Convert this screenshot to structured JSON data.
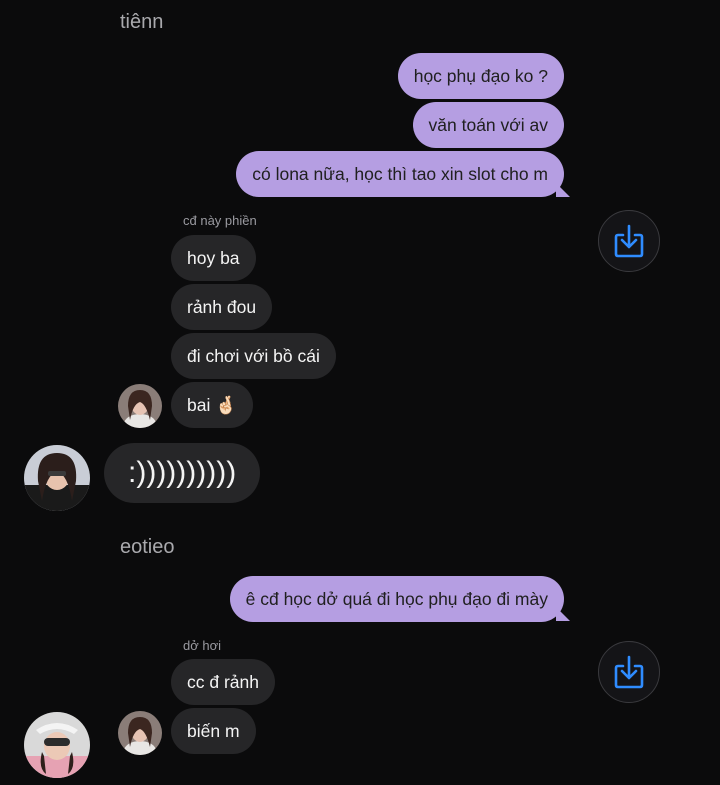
{
  "chat": {
    "sender_top": "tiênn",
    "sender_bottom": "eotieo",
    "outgoing_1": "học phụ đạo ko ?",
    "outgoing_2": "văn toán với av",
    "outgoing_3": "có lona nữa, học thì tao xin slot cho m",
    "reply_label_1": "cđ này phiền",
    "incoming_1": "hoy ba",
    "incoming_2": "rảnh đou",
    "incoming_3": "đi chơi với bồ cái",
    "incoming_4": "bai 🤞🏻",
    "incoming_big": ":))))))))))",
    "outgoing_4": "ê cđ học dở quá đi học phụ đạo đi mày",
    "reply_label_2": "dở hơi",
    "incoming_5": "cc đ rảnh",
    "incoming_6": "biến m"
  },
  "colors": {
    "background": "#0b0b0c",
    "outgoing_bubble": "#b59ee2",
    "incoming_bubble": "#262628",
    "share_icon": "#2f8cff"
  },
  "icons": [
    "share-download-icon",
    "avatar"
  ]
}
